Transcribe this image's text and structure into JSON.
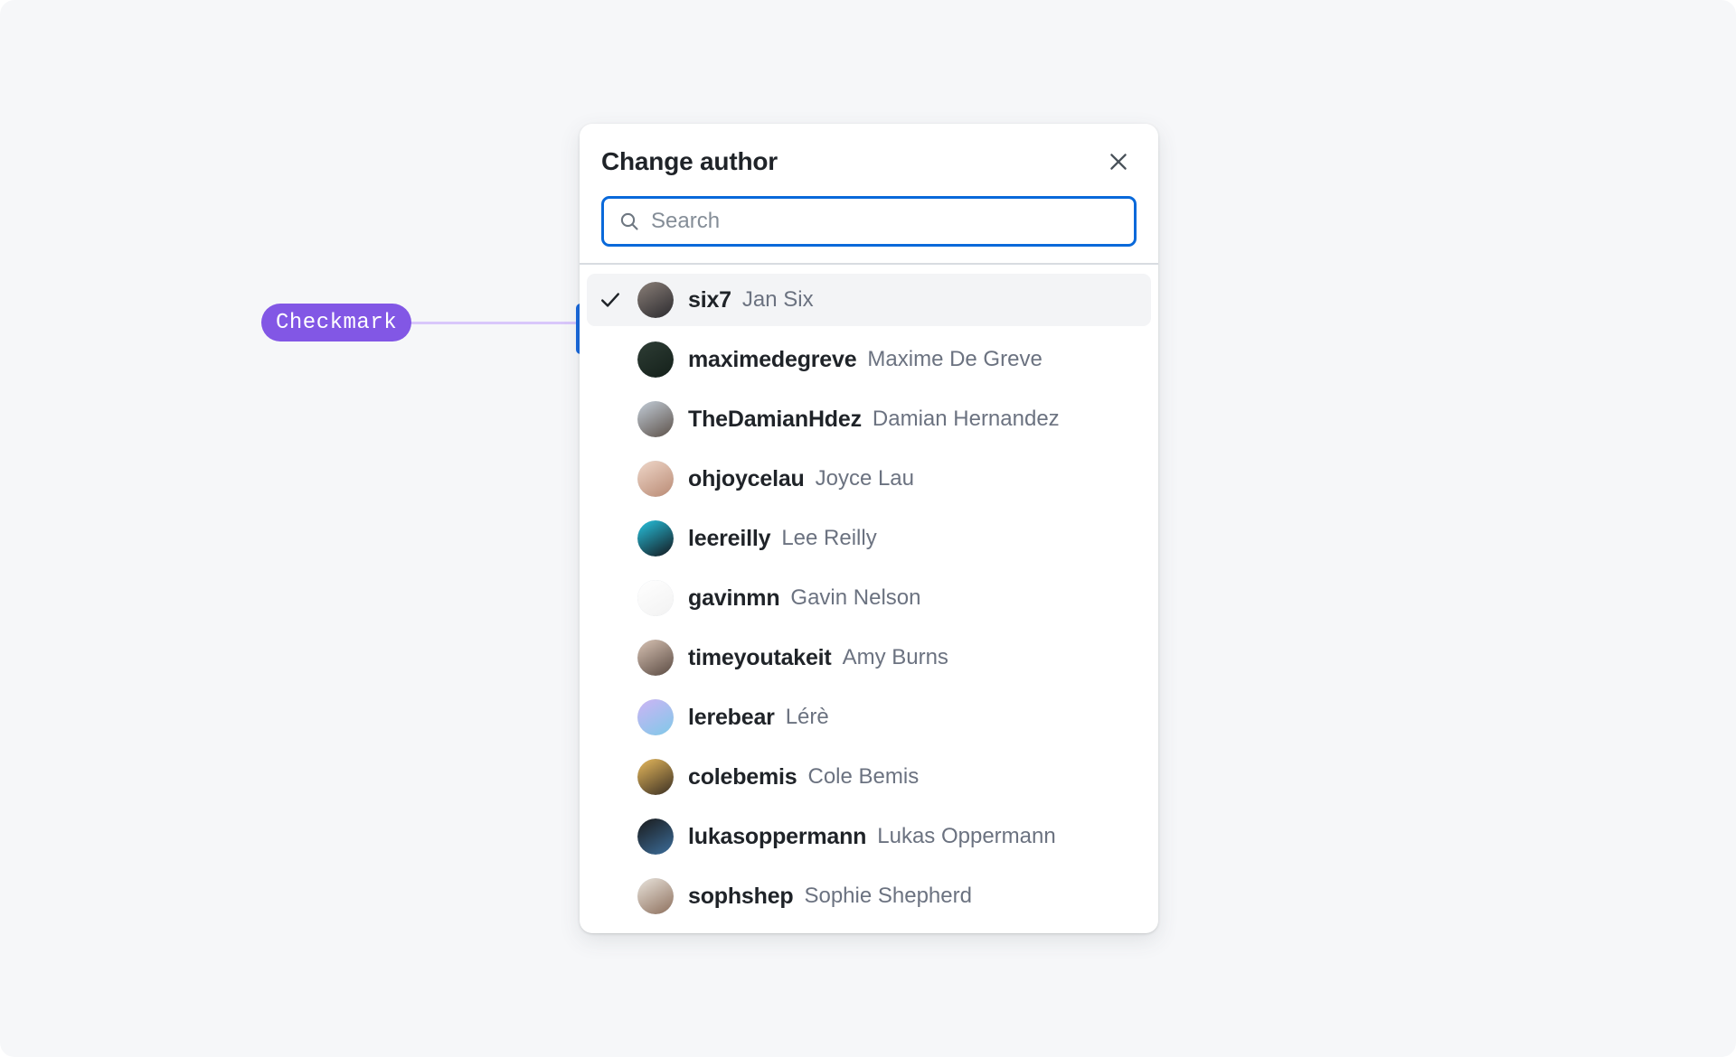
{
  "annotation": {
    "label": "Checkmark",
    "pill_color": "#8257e5",
    "line_color": "#d9c7fb",
    "dot_color": "#8b5cf6",
    "bar_color": "#1868dd"
  },
  "dialog": {
    "title": "Change author",
    "close_icon": "close-icon",
    "search": {
      "icon": "search-icon",
      "placeholder": "Search",
      "value": "",
      "focus_ring_color": "#0969da"
    },
    "people": [
      {
        "login": "six7",
        "name": "Jan Six",
        "selected": true,
        "avatar_from": "#8a7f78",
        "avatar_to": "#2b2a2e"
      },
      {
        "login": "maximedegreve",
        "name": "Maxime De Greve",
        "selected": false,
        "avatar_from": "#2e3d35",
        "avatar_to": "#14201a"
      },
      {
        "login": "TheDamianHdez",
        "name": "Damian Hernandez",
        "selected": false,
        "avatar_from": "#c3cdd8",
        "avatar_to": "#5c5149"
      },
      {
        "login": "ohjoycelau",
        "name": "Joyce Lau",
        "selected": false,
        "avatar_from": "#efd7c9",
        "avatar_to": "#b98a74"
      },
      {
        "login": "leereilly",
        "name": "Lee Reilly",
        "selected": false,
        "avatar_from": "#27c4e0",
        "avatar_to": "#14161c"
      },
      {
        "login": "gavinmn",
        "name": "Gavin Nelson",
        "selected": false,
        "avatar_from": "#ffffff",
        "avatar_to": "#f2f2f2"
      },
      {
        "login": "timeyoutakeit",
        "name": "Amy Burns",
        "selected": false,
        "avatar_from": "#d8c3b4",
        "avatar_to": "#5a4a42"
      },
      {
        "login": "lerebear",
        "name": "Lérè",
        "selected": false,
        "avatar_from": "#cdb4f5",
        "avatar_to": "#7fc9e8"
      },
      {
        "login": "colebemis",
        "name": "Cole Bemis",
        "selected": false,
        "avatar_from": "#e7b95c",
        "avatar_to": "#3a2f23"
      },
      {
        "login": "lukasoppermann",
        "name": "Lukas Oppermann",
        "selected": false,
        "avatar_from": "#1a1a1a",
        "avatar_to": "#3c6e9c"
      },
      {
        "login": "sophshep",
        "name": "Sophie Shepherd",
        "selected": false,
        "avatar_from": "#e9e4dc",
        "avatar_to": "#8d6f5c"
      }
    ]
  }
}
